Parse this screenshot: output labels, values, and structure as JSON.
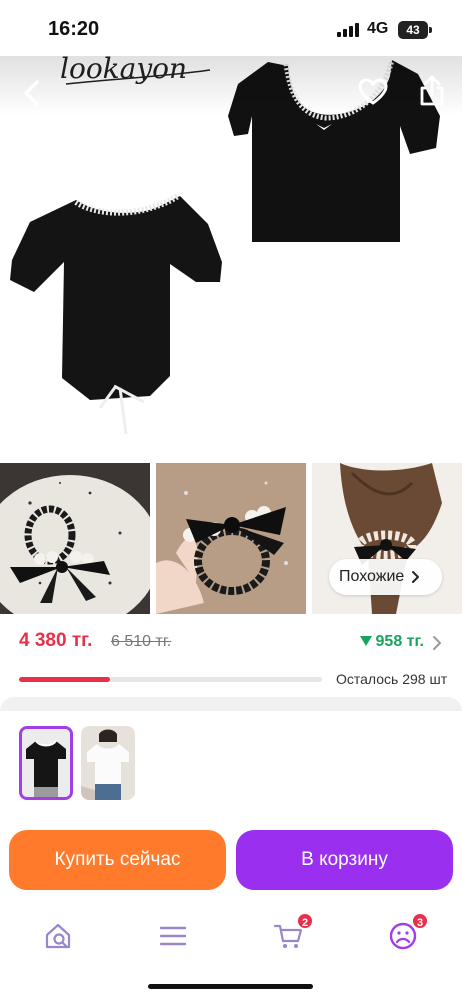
{
  "status_bar": {
    "time": "16:20",
    "network": "4G",
    "battery": "43"
  },
  "hero": {
    "brand_text": "lookayon",
    "image_icon": "product-photo-black-top-icon"
  },
  "gallery": {
    "similar_label": "Похожие",
    "thumbnails": [
      {
        "icon": "hair-tie-on-plate-icon"
      },
      {
        "icon": "hair-tie-in-hand-icon"
      },
      {
        "icon": "hair-tie-on-ponytail-icon"
      }
    ]
  },
  "price": {
    "current": "4 380 тг.",
    "old": "6 510 тг.",
    "discount": "958 тг.",
    "stock_text": "Осталось 298 шт",
    "stock_fraction": 0.3,
    "accent_color": "#e8304a",
    "discount_color": "#1aa35f"
  },
  "variants": [
    {
      "icon": "black-top-variant-icon",
      "selected": true
    },
    {
      "icon": "white-top-variant-icon",
      "selected": false
    }
  ],
  "actions": {
    "buy_now": "Купить сейчас",
    "add_to_cart": "В корзину",
    "buy_color": "#ff7a2b",
    "cart_color": "#9a2ff0"
  },
  "tab_bar": {
    "cart_badge": "2",
    "profile_badge": "3"
  }
}
